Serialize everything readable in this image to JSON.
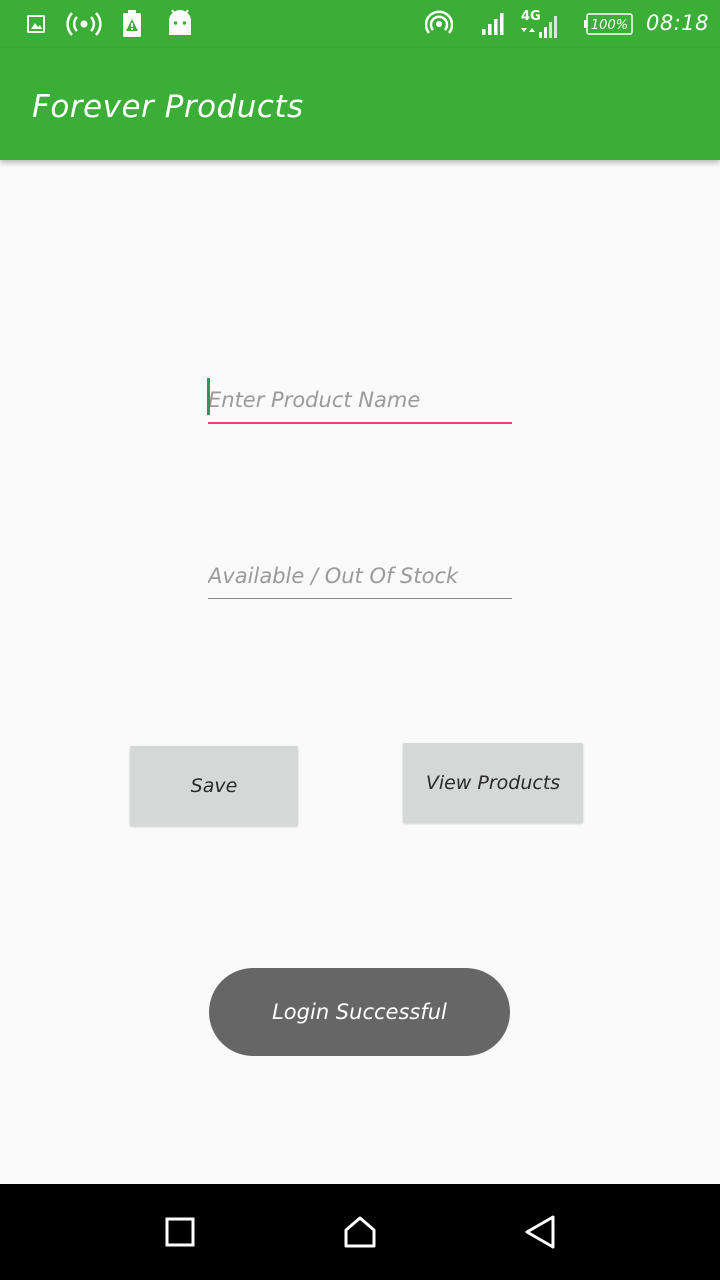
{
  "status_bar": {
    "time": "08:18",
    "battery": "100%",
    "network": "4G",
    "icons": [
      "image-icon",
      "hotspot-icon",
      "battery-alert-icon",
      "android-icon",
      "wifi-hotspot-icon",
      "signal-icon",
      "signal-4g-icon",
      "battery-icon"
    ]
  },
  "app_bar": {
    "title": "Forever Products"
  },
  "form": {
    "product_name_placeholder": "Enter Product Name",
    "stock_placeholder": "Available / Out Of Stock"
  },
  "buttons": {
    "save": "Save",
    "view_products": "View Products"
  },
  "toast": {
    "message": "Login Successful"
  },
  "nav": {
    "icons": [
      "recents-icon",
      "home-icon",
      "back-icon"
    ]
  },
  "colors": {
    "primary": "#3aae36",
    "accent": "#e0447a",
    "toast_bg": "#666666",
    "button_bg": "#d6d7d7"
  }
}
